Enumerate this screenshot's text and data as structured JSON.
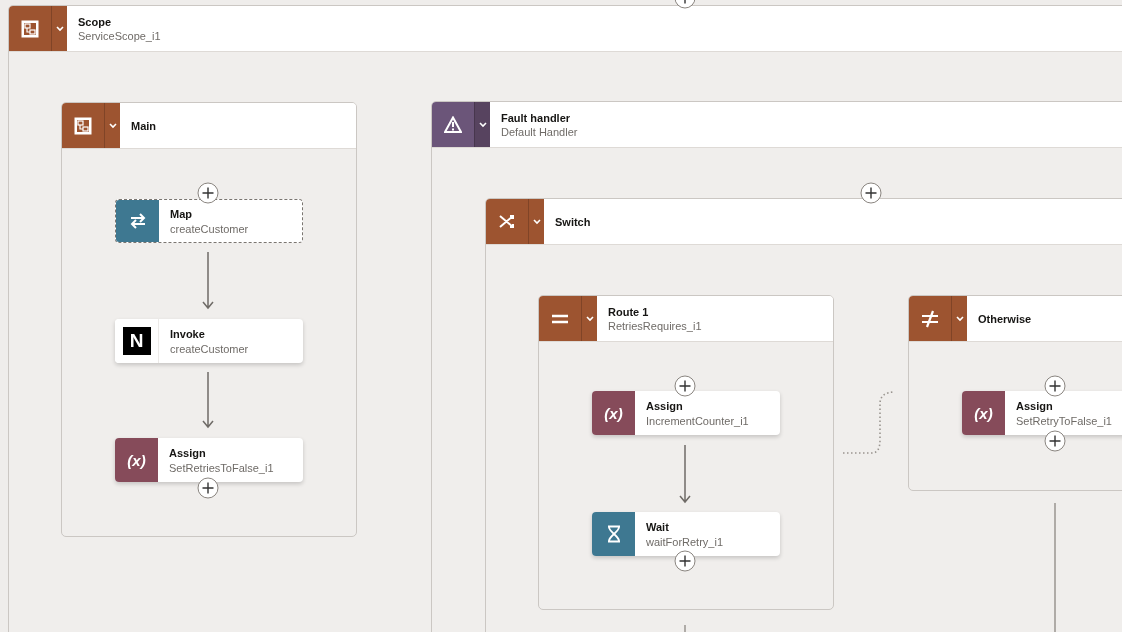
{
  "containers": [
    {
      "kind": "scope",
      "title": "Scope",
      "subtitle": "ServiceScope_i1"
    },
    {
      "kind": "scope",
      "title": "Main",
      "nodes": [
        {
          "kind": "map",
          "title": "Map",
          "subtitle": "createCustomer",
          "selected": true
        },
        {
          "kind": "invoke",
          "symbol": "N",
          "title": "Invoke",
          "subtitle": "createCustomer",
          "selected": false
        },
        {
          "kind": "assign",
          "symbol": "(x)",
          "title": "Assign",
          "subtitle": "SetRetriesToFalse_i1",
          "selected": false
        }
      ]
    },
    {
      "kind": "fault",
      "title": "Fault handler",
      "subtitle": "Default Handler"
    },
    {
      "kind": "switch",
      "title": "Switch"
    },
    {
      "kind": "route",
      "title": "Route 1",
      "subtitle": "RetriesRequires_i1",
      "nodes": [
        {
          "kind": "assign",
          "symbol": "(x)",
          "title": "Assign",
          "subtitle": "IncrementCounter_i1",
          "selected": false
        },
        {
          "kind": "wait",
          "title": "Wait",
          "subtitle": "waitForRetry_i1",
          "selected": false
        }
      ]
    },
    {
      "kind": "otherwise",
      "title": "Otherwise",
      "nodes": [
        {
          "kind": "assign",
          "symbol": "(x)",
          "title": "Assign",
          "subtitle": "SetRetryToFalse_i1",
          "selected": false
        }
      ]
    }
  ]
}
